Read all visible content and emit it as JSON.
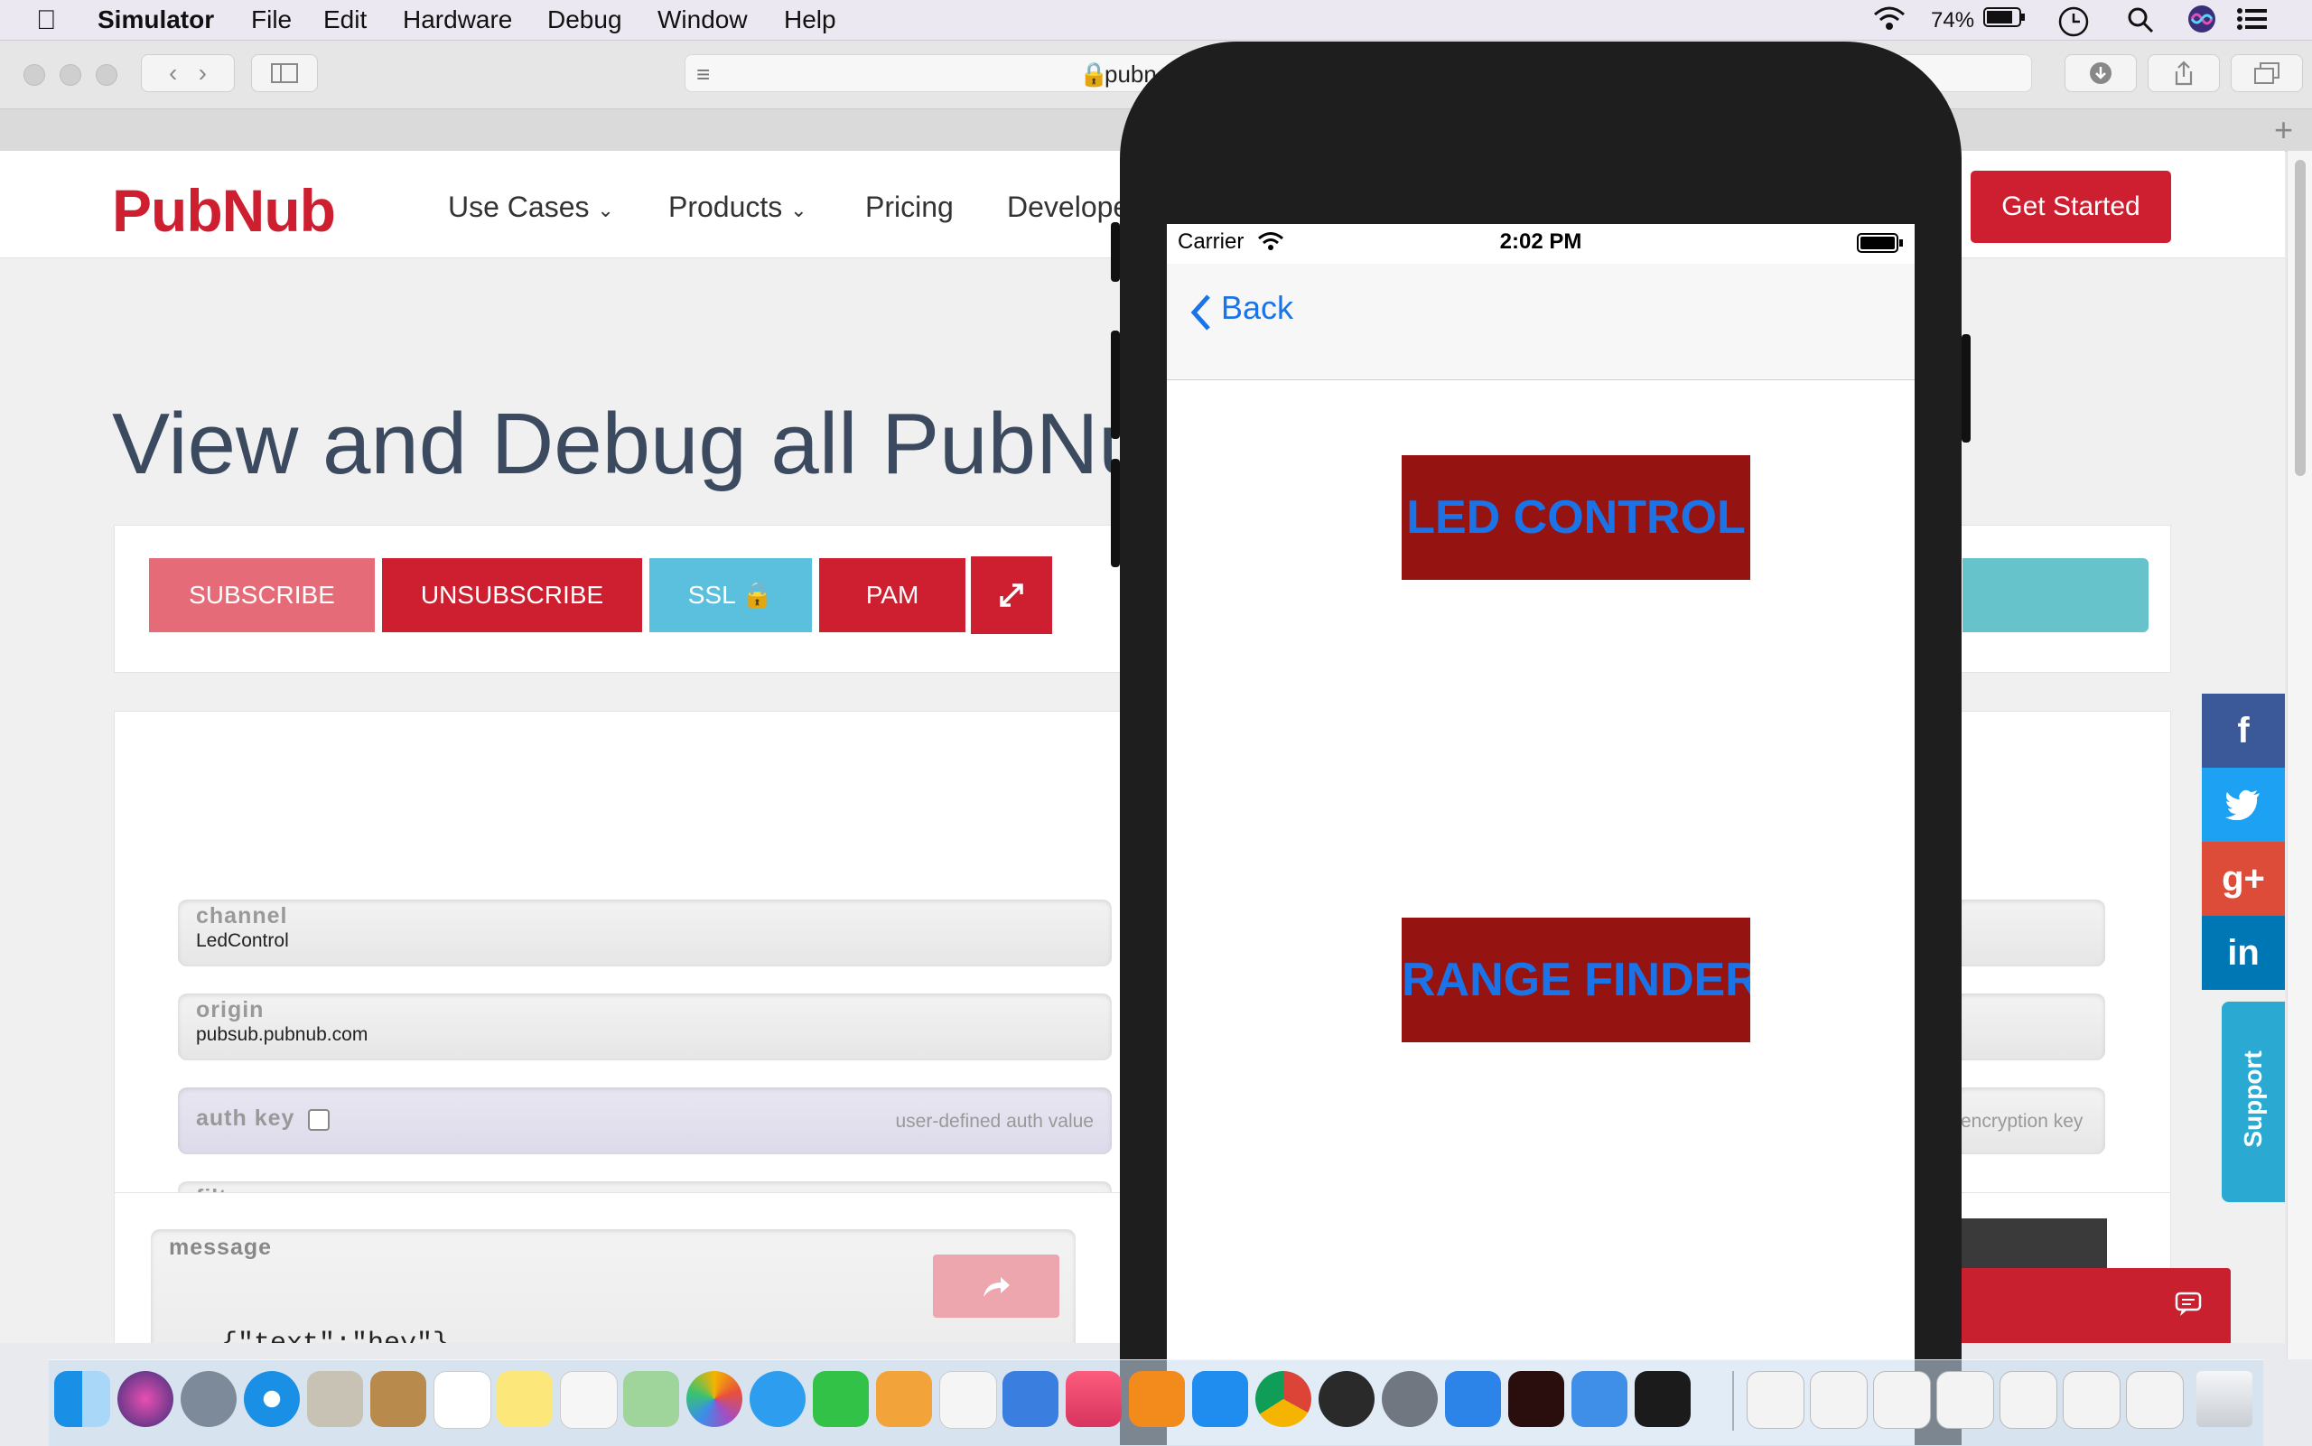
{
  "menubar": {
    "app": "Simulator",
    "items": [
      "File",
      "Edit",
      "Hardware",
      "Debug",
      "Window",
      "Help"
    ],
    "battery": "74%"
  },
  "browser": {
    "address": "pubn"
  },
  "website": {
    "logo": "PubNub",
    "nav": [
      "Use Cases",
      "Products",
      "Pricing",
      "Develope"
    ],
    "get_started": "Get Started",
    "headline": "View and Debug all PubNu",
    "buttons": {
      "subscribe": "SUBSCRIBE",
      "unsubscribe": "UNSUBSCRIBE",
      "ssl": "SSL",
      "pam": "PAM"
    },
    "fields": {
      "channel_label": "channel",
      "channel_value": "LedControl",
      "origin_label": "origin",
      "origin_value": "pubsub.pubnub.com",
      "auth_label": "auth key",
      "auth_placeholder": "user-defined auth value",
      "filter_label": "filter",
      "encryption_placeholder": "encryption key"
    },
    "message": {
      "label": "message",
      "value": "{\"text\":\"hey\"}"
    },
    "support": "Support",
    "social": [
      "f",
      "g+",
      "in"
    ]
  },
  "simulator": {
    "carrier": "Carrier",
    "time": "2:02 PM",
    "back": "Back",
    "btn_led": "LED CONTROL",
    "btn_range": "RANGE FINDER"
  },
  "colors": {
    "brand": "#ce1f30",
    "app_button": "#951412",
    "app_text": "#1a74e8"
  }
}
